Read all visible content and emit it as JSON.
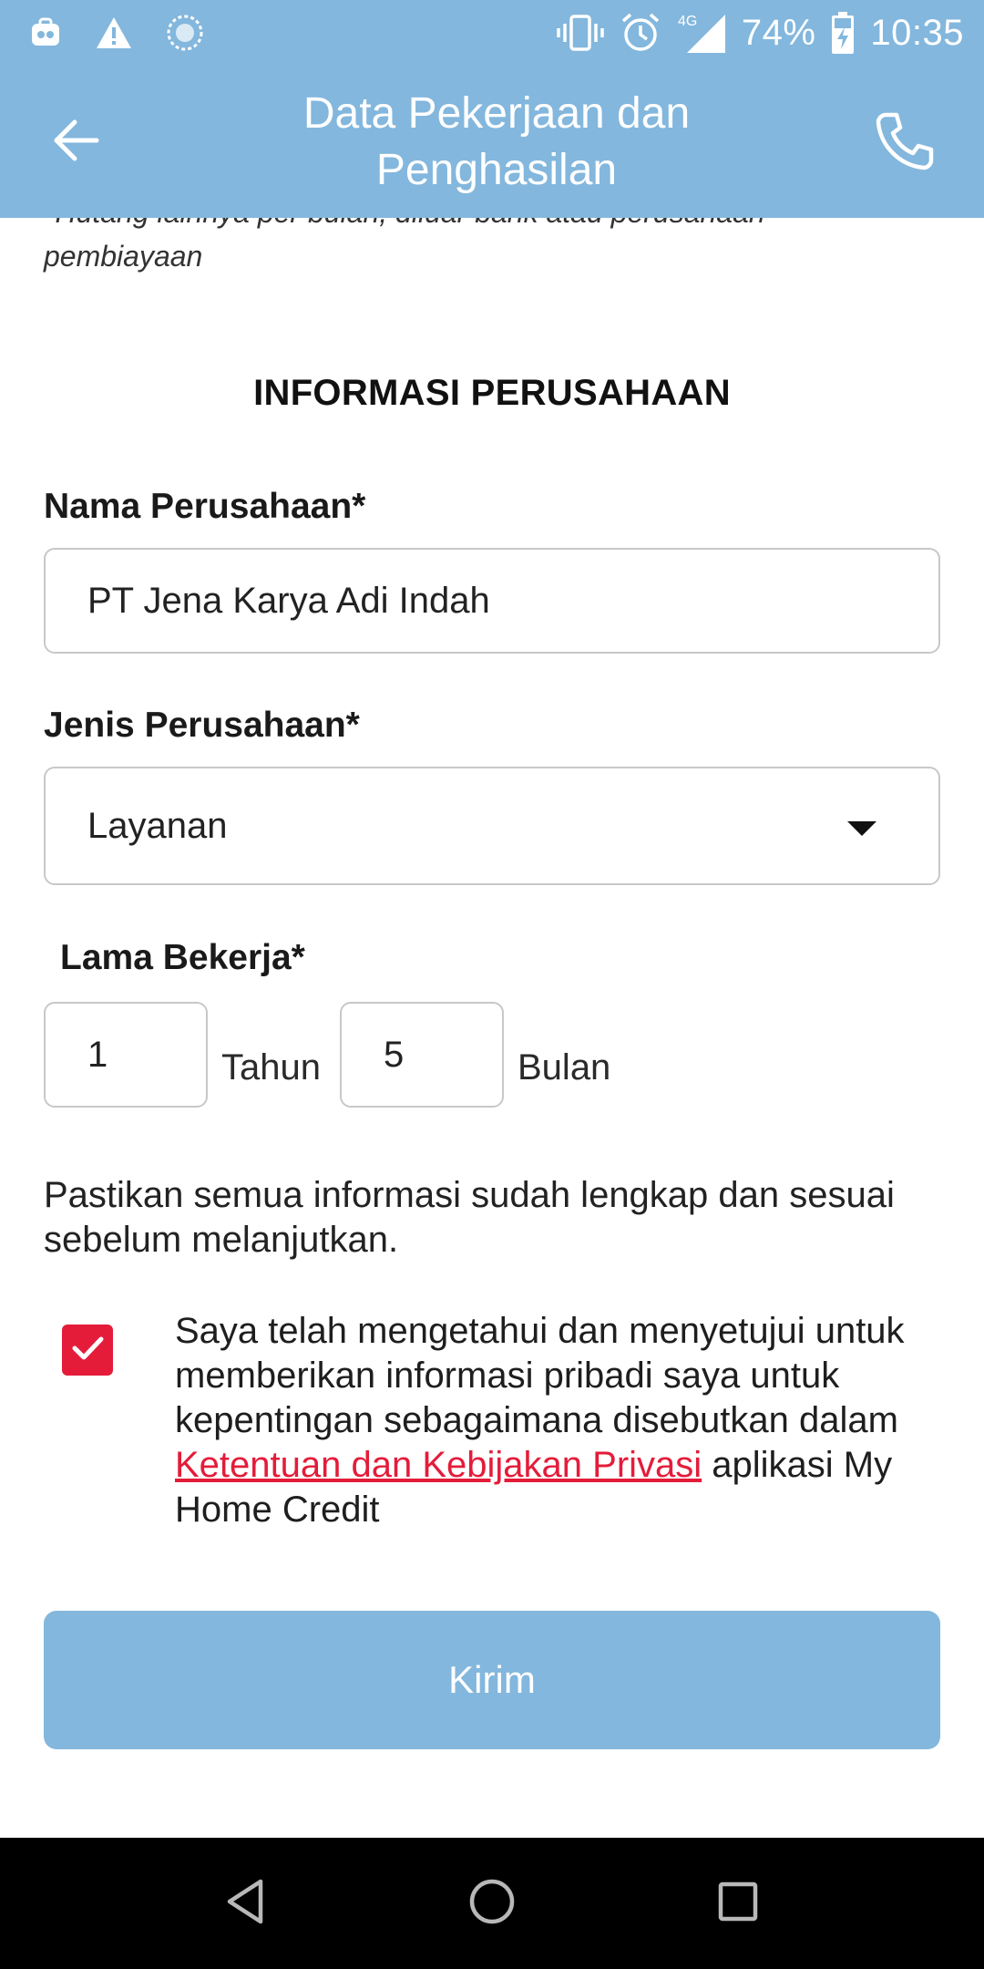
{
  "status_bar": {
    "left_icons": [
      "app-notification-icon",
      "warning-icon",
      "sync-icon"
    ],
    "network_label": "4G",
    "battery_percent": "74%",
    "time": "10:35",
    "right_icons": [
      "vibrate-icon",
      "alarm-icon",
      "signal-icon",
      "battery-charging-icon"
    ]
  },
  "app_bar": {
    "title_line1": "Data Pekerjaan dan",
    "title_line2": "Penghasilan",
    "back_icon": "back-arrow-icon",
    "call_icon": "phone-icon"
  },
  "prev_section": {
    "cut_line": "*Hutang lainnya per bulan, diluar bank atau perusahaan",
    "line2": "pembiayaan"
  },
  "company_section": {
    "title": "INFORMASI PERUSAHAAN",
    "company_name": {
      "label": "Nama Perusahaan*",
      "value": "PT Jena Karya Adi Indah"
    },
    "company_type": {
      "label": "Jenis Perusahaan*",
      "value": "Layanan"
    },
    "work_duration": {
      "label": "Lama Bekerja*",
      "years_value": "1",
      "years_unit": "Tahun",
      "months_value": "5",
      "months_unit": "Bulan"
    }
  },
  "notice": "Pastikan semua informasi sudah lengkap dan sesuai sebelum melanjutkan.",
  "consent": {
    "checked": true,
    "text_before": "Saya telah mengetahui dan menyetujui untuk memberikan informasi pribadi saya untuk kepentingan sebagaimana disebutkan dalam ",
    "link_text": "Ketentuan dan Kebijakan Privasi",
    "text_after": " aplikasi My Home Credit"
  },
  "submit_button": {
    "label": "Kirim"
  },
  "nav_bar": {
    "buttons": [
      "back-triangle-icon",
      "home-circle-icon",
      "recents-square-icon"
    ]
  },
  "colors": {
    "primary_blue": "#83b7dd",
    "accent_red": "#e41c3a",
    "nav_black": "#000000"
  }
}
